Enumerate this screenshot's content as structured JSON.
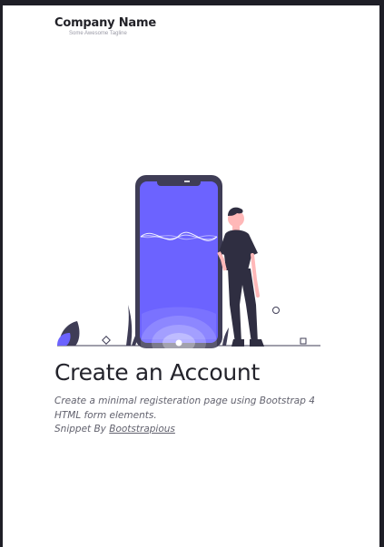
{
  "brand": {
    "name": "Company Name",
    "tagline": "Some Awesome Tagline"
  },
  "illustration": {
    "icon": "person-leaning-on-phone-illustration",
    "accent": "#6c63ff",
    "dark": "#3f3d56",
    "skin": "#ffb8b8"
  },
  "hero": {
    "title": "Create an Account",
    "description": "Create a minimal registeration page using Bootstrap 4 HTML form elements.",
    "snippet_prefix": "Snippet By",
    "snippet_link": "Bootstrapious"
  }
}
